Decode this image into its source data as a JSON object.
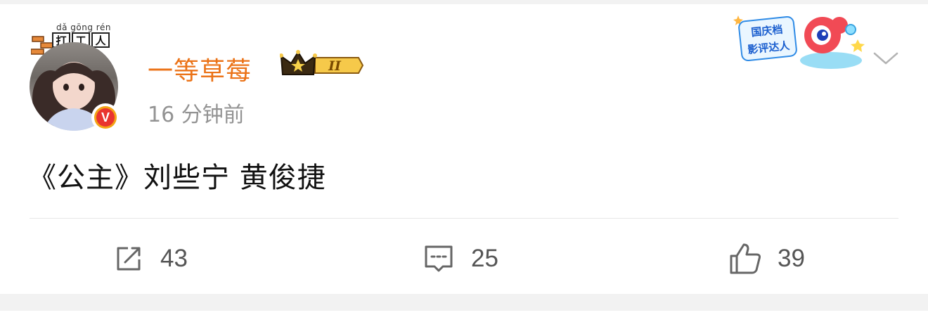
{
  "post": {
    "username": "一等草莓",
    "vip_level": "II",
    "timestamp": "16 分钟前",
    "content": "《公主》刘些宁 黄俊捷",
    "pendant": {
      "pinyin": "dǎ gōng rén",
      "chars": [
        "打",
        "工",
        "人"
      ]
    },
    "sticker": {
      "line1": "国庆档",
      "line2": "影评达人"
    },
    "verified_icon": "v-verified-icon",
    "actions": {
      "repost": {
        "icon": "share-icon",
        "count": "43"
      },
      "comment": {
        "icon": "comment-icon",
        "count": "25"
      },
      "like": {
        "icon": "thumbs-up-icon",
        "count": "39"
      }
    }
  },
  "colors": {
    "username": "#eb7318",
    "timestamp": "#939393",
    "text": "#111111",
    "action": "#555555",
    "background": "#f2f2f2",
    "card": "#ffffff"
  }
}
